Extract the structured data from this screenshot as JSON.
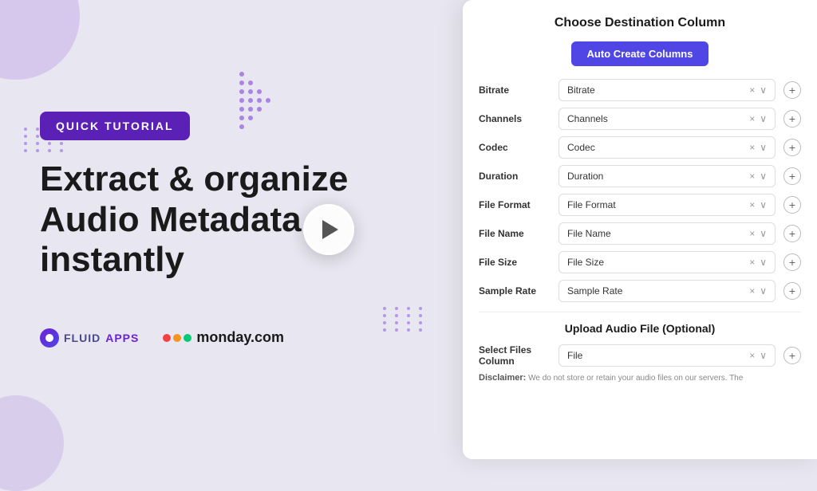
{
  "left": {
    "badge_text": "QUICK TUTORIAL",
    "heading_line1": "Extract & organize",
    "heading_line2": "Audio Metadata",
    "heading_line3": "instantly",
    "fluid_label": "FLUID",
    "apps_label": "APPS",
    "monday_label": "monday.com"
  },
  "right": {
    "panel_title": "Choose Destination Column",
    "auto_create_btn": "Auto Create Columns",
    "fields": [
      {
        "label": "Bitrate",
        "value": "Bitrate"
      },
      {
        "label": "Channels",
        "value": "Channels"
      },
      {
        "label": "Codec",
        "value": "Codec"
      },
      {
        "label": "Duration",
        "value": "Duration"
      },
      {
        "label": "File Format",
        "value": "File Format"
      },
      {
        "label": "File Name",
        "value": "File Name"
      },
      {
        "label": "File Size",
        "value": "File Size"
      },
      {
        "label": "Sample Rate",
        "value": "Sample Rate"
      }
    ],
    "upload_section_title": "Upload Audio File (Optional)",
    "select_files_label": "Select Files Column",
    "select_files_value": "File",
    "disclaimer_title": "Disclaimer:",
    "disclaimer_text": "We do not store or retain your audio files on our servers. The"
  },
  "colors": {
    "purple": "#5b21b6",
    "blue": "#4f46e5",
    "monday_red": "#f34141",
    "monday_orange": "#f7941d",
    "monday_green": "#00ca72"
  }
}
